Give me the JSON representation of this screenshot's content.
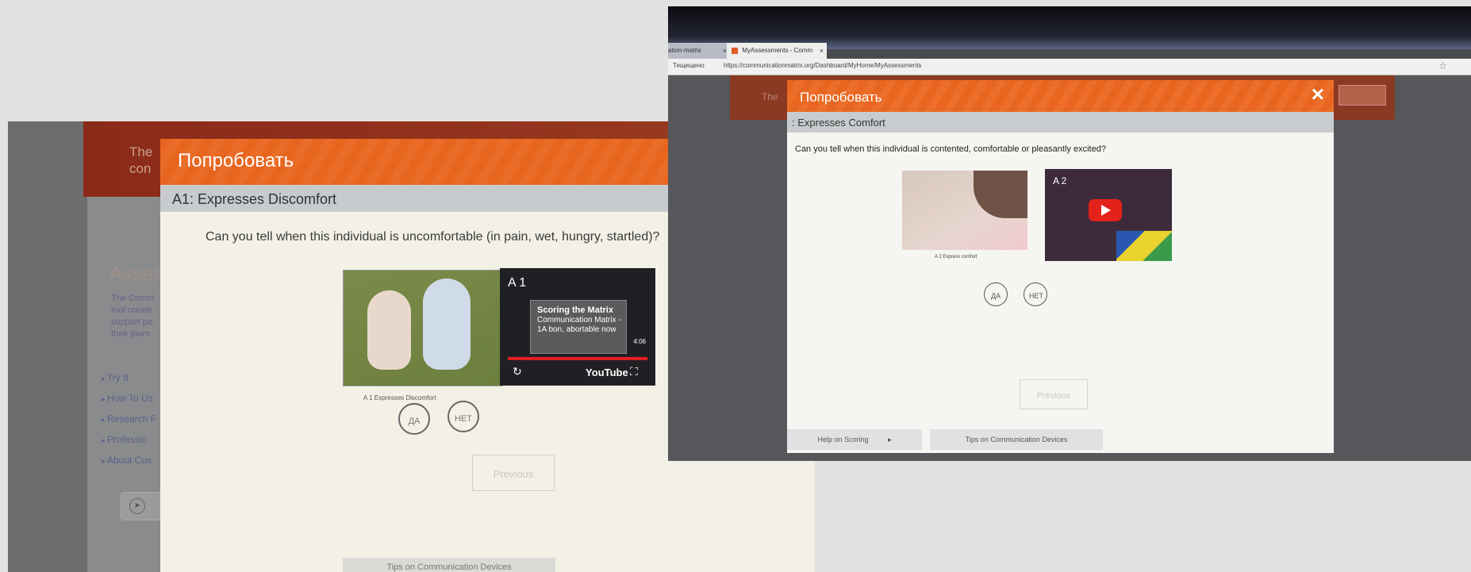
{
  "left": {
    "background_banner": "The\ncon",
    "background_heading": "Asses",
    "background_para": "The Comm\ntool create\nsupport pe\ntheir journ",
    "background_list": [
      "Try It",
      "How To Us",
      "Research F",
      "Professio",
      "About Cus"
    ],
    "background_pill_icon": "T",
    "modal": {
      "title": "Попробовать",
      "close": "×",
      "section": "A1: Expresses Discomfort",
      "question": "Can you tell when this individual is uncomfortable (in pain, wet, hungry, startled)?",
      "photo_caption": "A 1 Expresses Discomfort",
      "video": {
        "label": "A 1",
        "title": "Scoring the Matrix",
        "subtitle": "Communication Matrix -\n1A bon, abortable now",
        "time": "4:06",
        "replay_icon": "↻",
        "brand": "YouTube",
        "fullscreen_icon": "⛶"
      },
      "yes_label": "ДА",
      "no_label": "НЕТ",
      "previous_label": "Previous",
      "tips_label": "Tips on Communication Devices"
    }
  },
  "right": {
    "browser": {
      "tab1": "cation-matrix",
      "tab2": "MyAssessments - Comm",
      "tab_close": "×",
      "status": "Тещищено",
      "url": "https://communicationmatrix.org/Dashboard/MyHome/MyAssessments"
    },
    "background_banner": "The",
    "modal": {
      "title": "Попробовать",
      "close": "×",
      "section": ": Expresses Comfort",
      "question": "Can you tell when this individual is contented, comfortable or pleasantly excited?",
      "photo_caption": "A 2  Express comfort",
      "video_label": "A 2",
      "yes_label": "ДА",
      "no_label": "НЕТ",
      "previous_label": "Previous",
      "help_label": "Help on Scoring",
      "tips_label": "Tips on Communication Devices"
    }
  }
}
